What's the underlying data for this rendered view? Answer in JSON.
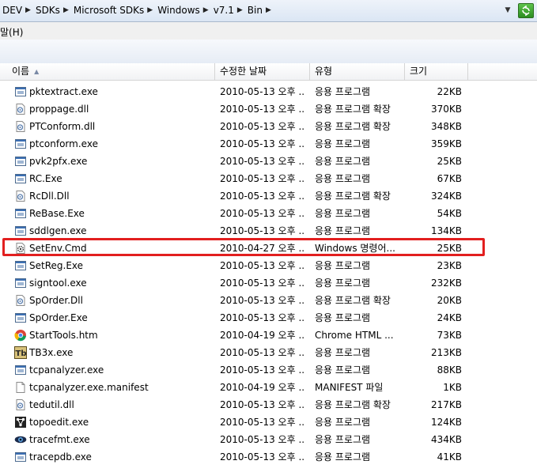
{
  "address": {
    "crumbs": [
      "DEV",
      "SDKs",
      "Microsoft SDKs",
      "Windows",
      "v7.1",
      "Bin"
    ]
  },
  "menu": {
    "help": "말(H)"
  },
  "columns": {
    "name": "이름",
    "date": "수정한 날짜",
    "type": "유형",
    "size": "크기"
  },
  "files": [
    {
      "name": "pktextract.exe",
      "date": "2010-05-13 오후 ...",
      "type": "응용 프로그램",
      "size": "22KB",
      "icon": "exe-icon"
    },
    {
      "name": "proppage.dll",
      "date": "2010-05-13 오후 ...",
      "type": "응용 프로그램 확장",
      "size": "370KB",
      "icon": "dll-icon"
    },
    {
      "name": "PTConform.dll",
      "date": "2010-05-13 오후 ...",
      "type": "응용 프로그램 확장",
      "size": "348KB",
      "icon": "dll-icon"
    },
    {
      "name": "ptconform.exe",
      "date": "2010-05-13 오후 ...",
      "type": "응용 프로그램",
      "size": "359KB",
      "icon": "exe-icon"
    },
    {
      "name": "pvk2pfx.exe",
      "date": "2010-05-13 오후 ...",
      "type": "응용 프로그램",
      "size": "25KB",
      "icon": "exe-icon"
    },
    {
      "name": "RC.Exe",
      "date": "2010-05-13 오후 ...",
      "type": "응용 프로그램",
      "size": "67KB",
      "icon": "exe-icon"
    },
    {
      "name": "RcDll.Dll",
      "date": "2010-05-13 오후 ...",
      "type": "응용 프로그램 확장",
      "size": "324KB",
      "icon": "dll-icon"
    },
    {
      "name": "ReBase.Exe",
      "date": "2010-05-13 오후 ...",
      "type": "응용 프로그램",
      "size": "54KB",
      "icon": "exe-icon"
    },
    {
      "name": "sddlgen.exe",
      "date": "2010-05-13 오후 ...",
      "type": "응용 프로그램",
      "size": "134KB",
      "icon": "exe-icon"
    },
    {
      "name": "SetEnv.Cmd",
      "date": "2010-04-27 오후 ...",
      "type": "Windows 명령어...",
      "size": "25KB",
      "icon": "cmd-gear-icon"
    },
    {
      "name": "SetReg.Exe",
      "date": "2010-05-13 오후 ...",
      "type": "응용 프로그램",
      "size": "23KB",
      "icon": "exe-icon"
    },
    {
      "name": "signtool.exe",
      "date": "2010-05-13 오후 ...",
      "type": "응용 프로그램",
      "size": "232KB",
      "icon": "exe-icon"
    },
    {
      "name": "SpOrder.Dll",
      "date": "2010-05-13 오후 ...",
      "type": "응용 프로그램 확장",
      "size": "20KB",
      "icon": "dll-icon"
    },
    {
      "name": "SpOrder.Exe",
      "date": "2010-05-13 오후 ...",
      "type": "응용 프로그램",
      "size": "24KB",
      "icon": "exe-icon"
    },
    {
      "name": "StartTools.htm",
      "date": "2010-04-19 오후 ...",
      "type": "Chrome HTML ...",
      "size": "73KB",
      "icon": "chrome-icon"
    },
    {
      "name": "TB3x.exe",
      "date": "2010-05-13 오후 ...",
      "type": "응용 프로그램",
      "size": "213KB",
      "icon": "tb3x-icon"
    },
    {
      "name": "tcpanalyzer.exe",
      "date": "2010-05-13 오후 ...",
      "type": "응용 프로그램",
      "size": "88KB",
      "icon": "exe-icon"
    },
    {
      "name": "tcpanalyzer.exe.manifest",
      "date": "2010-04-19 오후 ...",
      "type": "MANIFEST 파일",
      "size": "1KB",
      "icon": "blank-file-icon"
    },
    {
      "name": "tedutil.dll",
      "date": "2010-05-13 오후 ...",
      "type": "응용 프로그램 확장",
      "size": "217KB",
      "icon": "dll-icon"
    },
    {
      "name": "topoedit.exe",
      "date": "2010-05-13 오후 ...",
      "type": "응용 프로그램",
      "size": "124KB",
      "icon": "topoedit-icon"
    },
    {
      "name": "tracefmt.exe",
      "date": "2010-05-13 오후 ...",
      "type": "응용 프로그램",
      "size": "434KB",
      "icon": "tracefmt-eye-icon"
    },
    {
      "name": "tracepdb.exe",
      "date": "2010-05-13 오후 ...",
      "type": "응용 프로그램",
      "size": "41KB",
      "icon": "exe-icon"
    }
  ],
  "highlighted_file": "SetEnv.Cmd",
  "colors": {
    "highlight_border": "#e21f1f",
    "refresh_green": "#3aa52b"
  }
}
